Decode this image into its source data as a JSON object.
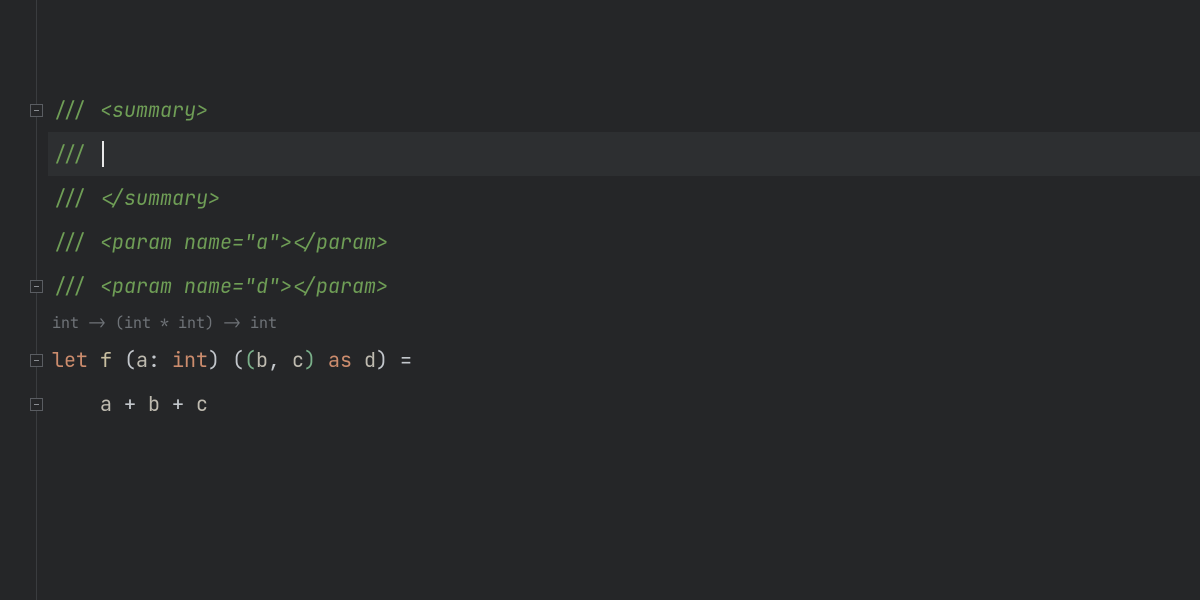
{
  "editor": {
    "top_padding_lines": 2,
    "lines": [
      {
        "tokens": [
          {
            "t": "/// ",
            "cls": "c-slash"
          },
          {
            "t": "<",
            "cls": "c-doctag"
          },
          {
            "t": "summary",
            "cls": "c-doctag"
          },
          {
            "t": ">",
            "cls": "c-doctag"
          }
        ],
        "fold": true
      },
      {
        "tokens": [
          {
            "t": "/// ",
            "cls": "c-slash"
          }
        ],
        "active": true,
        "cursor_after": true
      },
      {
        "tokens": [
          {
            "t": "/// ",
            "cls": "c-slash"
          },
          {
            "t": "</",
            "cls": "c-doctag"
          },
          {
            "t": "summary",
            "cls": "c-doctag"
          },
          {
            "t": ">",
            "cls": "c-doctag"
          }
        ]
      },
      {
        "tokens": [
          {
            "t": "/// ",
            "cls": "c-slash"
          },
          {
            "t": "<",
            "cls": "c-doctag"
          },
          {
            "t": "param",
            "cls": "c-doctag"
          },
          {
            "t": " ",
            "cls": "c-doctag"
          },
          {
            "t": "name",
            "cls": "c-attr"
          },
          {
            "t": "=",
            "cls": "c-doctag"
          },
          {
            "t": "\"a\"",
            "cls": "c-str"
          },
          {
            "t": ">",
            "cls": "c-doctag"
          },
          {
            "t": "</",
            "cls": "c-doctag"
          },
          {
            "t": "param",
            "cls": "c-doctag"
          },
          {
            "t": ">",
            "cls": "c-doctag"
          }
        ]
      },
      {
        "tokens": [
          {
            "t": "/// ",
            "cls": "c-slash"
          },
          {
            "t": "<",
            "cls": "c-doctag"
          },
          {
            "t": "param",
            "cls": "c-doctag"
          },
          {
            "t": " ",
            "cls": "c-doctag"
          },
          {
            "t": "name",
            "cls": "c-attr"
          },
          {
            "t": "=",
            "cls": "c-doctag"
          },
          {
            "t": "\"d\"",
            "cls": "c-str"
          },
          {
            "t": ">",
            "cls": "c-doctag"
          },
          {
            "t": "</",
            "cls": "c-doctag"
          },
          {
            "t": "param",
            "cls": "c-doctag"
          },
          {
            "t": ">",
            "cls": "c-doctag"
          }
        ],
        "fold": true
      },
      {
        "hint": "int -> (int * int) -> int"
      },
      {
        "tokens": [
          {
            "t": "let",
            "cls": "c-keyword"
          },
          {
            "t": " ",
            "cls": ""
          },
          {
            "t": "f",
            "cls": "c-func"
          },
          {
            "t": " ",
            "cls": ""
          },
          {
            "t": "(",
            "cls": "c-paren1"
          },
          {
            "t": "a",
            "cls": "c-ident"
          },
          {
            "t": ":",
            "cls": "c-punc"
          },
          {
            "t": " ",
            "cls": ""
          },
          {
            "t": "int",
            "cls": "c-type"
          },
          {
            "t": ")",
            "cls": "c-paren1"
          },
          {
            "t": " ",
            "cls": ""
          },
          {
            "t": "(",
            "cls": "c-paren1"
          },
          {
            "t": "(",
            "cls": "c-paren2"
          },
          {
            "t": "b",
            "cls": "c-ident"
          },
          {
            "t": ",",
            "cls": "c-punc"
          },
          {
            "t": " ",
            "cls": ""
          },
          {
            "t": "c",
            "cls": "c-ident"
          },
          {
            "t": ")",
            "cls": "c-paren2"
          },
          {
            "t": " ",
            "cls": ""
          },
          {
            "t": "as",
            "cls": "c-keyword"
          },
          {
            "t": " ",
            "cls": ""
          },
          {
            "t": "d",
            "cls": "c-ident"
          },
          {
            "t": ")",
            "cls": "c-paren1"
          },
          {
            "t": " ",
            "cls": ""
          },
          {
            "t": "=",
            "cls": "c-op"
          }
        ],
        "fold": true
      },
      {
        "tokens": [
          {
            "t": "    ",
            "cls": ""
          },
          {
            "t": "a",
            "cls": "c-ident"
          },
          {
            "t": " ",
            "cls": ""
          },
          {
            "t": "+",
            "cls": "c-op"
          },
          {
            "t": " ",
            "cls": ""
          },
          {
            "t": "b",
            "cls": "c-ident"
          },
          {
            "t": " ",
            "cls": ""
          },
          {
            "t": "+",
            "cls": "c-op"
          },
          {
            "t": " ",
            "cls": ""
          },
          {
            "t": "c",
            "cls": "c-ident"
          }
        ],
        "fold": true
      }
    ]
  }
}
